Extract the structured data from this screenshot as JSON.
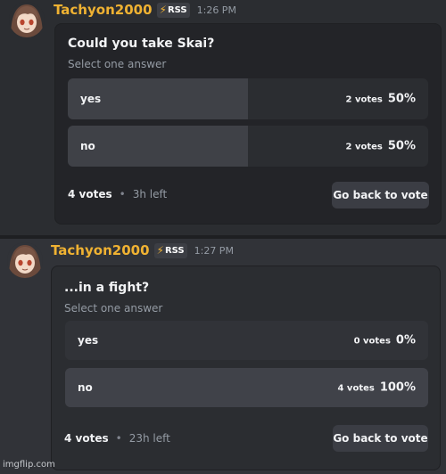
{
  "messages": [
    {
      "username": "Tachyon2000",
      "badge_icon": "bolt-icon",
      "badge_label": "RSS",
      "time": "1:26 PM",
      "poll": {
        "question": "Could you take Skai?",
        "subtitle": "Select one answer",
        "options": [
          {
            "label": "yes",
            "votes": "2 votes",
            "percent": "50%",
            "share": 0.5
          },
          {
            "label": "no",
            "votes": "2 votes",
            "percent": "50%",
            "share": 0.5
          }
        ],
        "total": "4 votes",
        "remaining": "3h left",
        "button": "Go back to vote"
      }
    },
    {
      "username": "Tachyon2000",
      "badge_icon": "bolt-icon",
      "badge_label": "RSS",
      "time": "1:27 PM",
      "poll": {
        "question": "...in a fight?",
        "subtitle": "Select one answer",
        "options": [
          {
            "label": "yes",
            "votes": "0 votes",
            "percent": "0%",
            "share": 0.0
          },
          {
            "label": "no",
            "votes": "4 votes",
            "percent": "100%",
            "share": 1.0
          }
        ],
        "total": "4 votes",
        "remaining": "23h left",
        "button": "Go back to vote"
      }
    }
  ],
  "separator": "•",
  "watermark": "imgflip.com",
  "colors": {
    "username": "#f0b232",
    "fill": "#3f4147",
    "background": "#2b2d31"
  }
}
